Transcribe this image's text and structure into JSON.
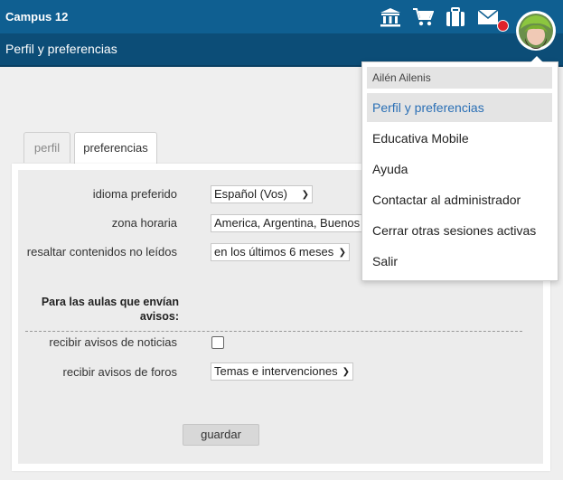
{
  "header": {
    "brand": "Campus 12",
    "subtitle": "Perfil y preferencias",
    "icons": [
      "institution-icon",
      "cart-icon",
      "briefcase-icon",
      "mail-icon"
    ],
    "accent_color": "#0f5f91",
    "subbar_color": "#0c4d77",
    "notification_color": "#e0222a"
  },
  "tabs": [
    {
      "label": "perfil",
      "active": false
    },
    {
      "label": "preferencias",
      "active": true
    }
  ],
  "form": {
    "language": {
      "label": "idioma preferido",
      "value": "Español (Vos)"
    },
    "timezone": {
      "label": "zona horaria",
      "value": "America, Argentina, Buenos Aires"
    },
    "unread": {
      "label": "resaltar contenidos no leídos",
      "value": "en los últimos 6 meses"
    },
    "section_title": "Para las aulas que envían avisos:",
    "news": {
      "label": "recibir avisos de noticias",
      "checked": false
    },
    "forums": {
      "label": "recibir avisos de foros",
      "value": "Temas e intervenciones"
    },
    "save_label": "guardar"
  },
  "user_menu": {
    "user_name": "Ailén Ailenis",
    "items": [
      {
        "label": "Perfil y preferencias",
        "active": true
      },
      {
        "label": "Educativa Mobile",
        "active": false
      },
      {
        "label": "Ayuda",
        "active": false
      },
      {
        "label": "Contactar al administrador",
        "active": false
      },
      {
        "label": "Cerrar otras sesiones activas",
        "active": false
      },
      {
        "label": "Salir",
        "active": false
      }
    ]
  }
}
